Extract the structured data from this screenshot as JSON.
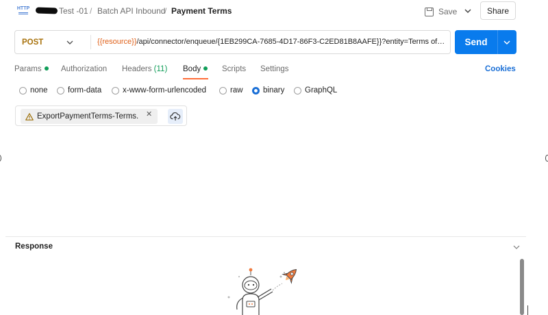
{
  "header": {
    "method_icon": "HTTP",
    "breadcrumb": [
      "Test -01",
      "Batch API Inbound",
      "Payment Terms"
    ],
    "separator": "/",
    "save_label": "Save",
    "share_label": "Share"
  },
  "request": {
    "method": "POST",
    "url_variable": "{{resource}}",
    "url_rest": "/api/connector/enqueue/{1EB299CA-7685-4D17-86F3-C2ED81B8AAFE}}?entity=Terms of payment&company=USMF",
    "send_label": "Send"
  },
  "tabs": {
    "params": "Params",
    "authorization": "Authorization",
    "headers": "Headers",
    "headers_count": "(11)",
    "body": "Body",
    "scripts": "Scripts",
    "settings": "Settings",
    "active": "Body",
    "cookies": "Cookies"
  },
  "body_types": {
    "options": [
      "none",
      "form-data",
      "x-www-form-urlencoded",
      "raw",
      "binary",
      "GraphQL"
    ],
    "selected": "binary"
  },
  "file": {
    "name": "ExportPaymentTerms-Terms...",
    "status_icon": "warning-icon"
  },
  "response": {
    "title": "Response"
  },
  "colors": {
    "accent": "#097bed",
    "method": "#a8720c",
    "variable": "#e0611a",
    "tab_underline": "#ff6c37",
    "status_dot": "#0f9d58"
  }
}
